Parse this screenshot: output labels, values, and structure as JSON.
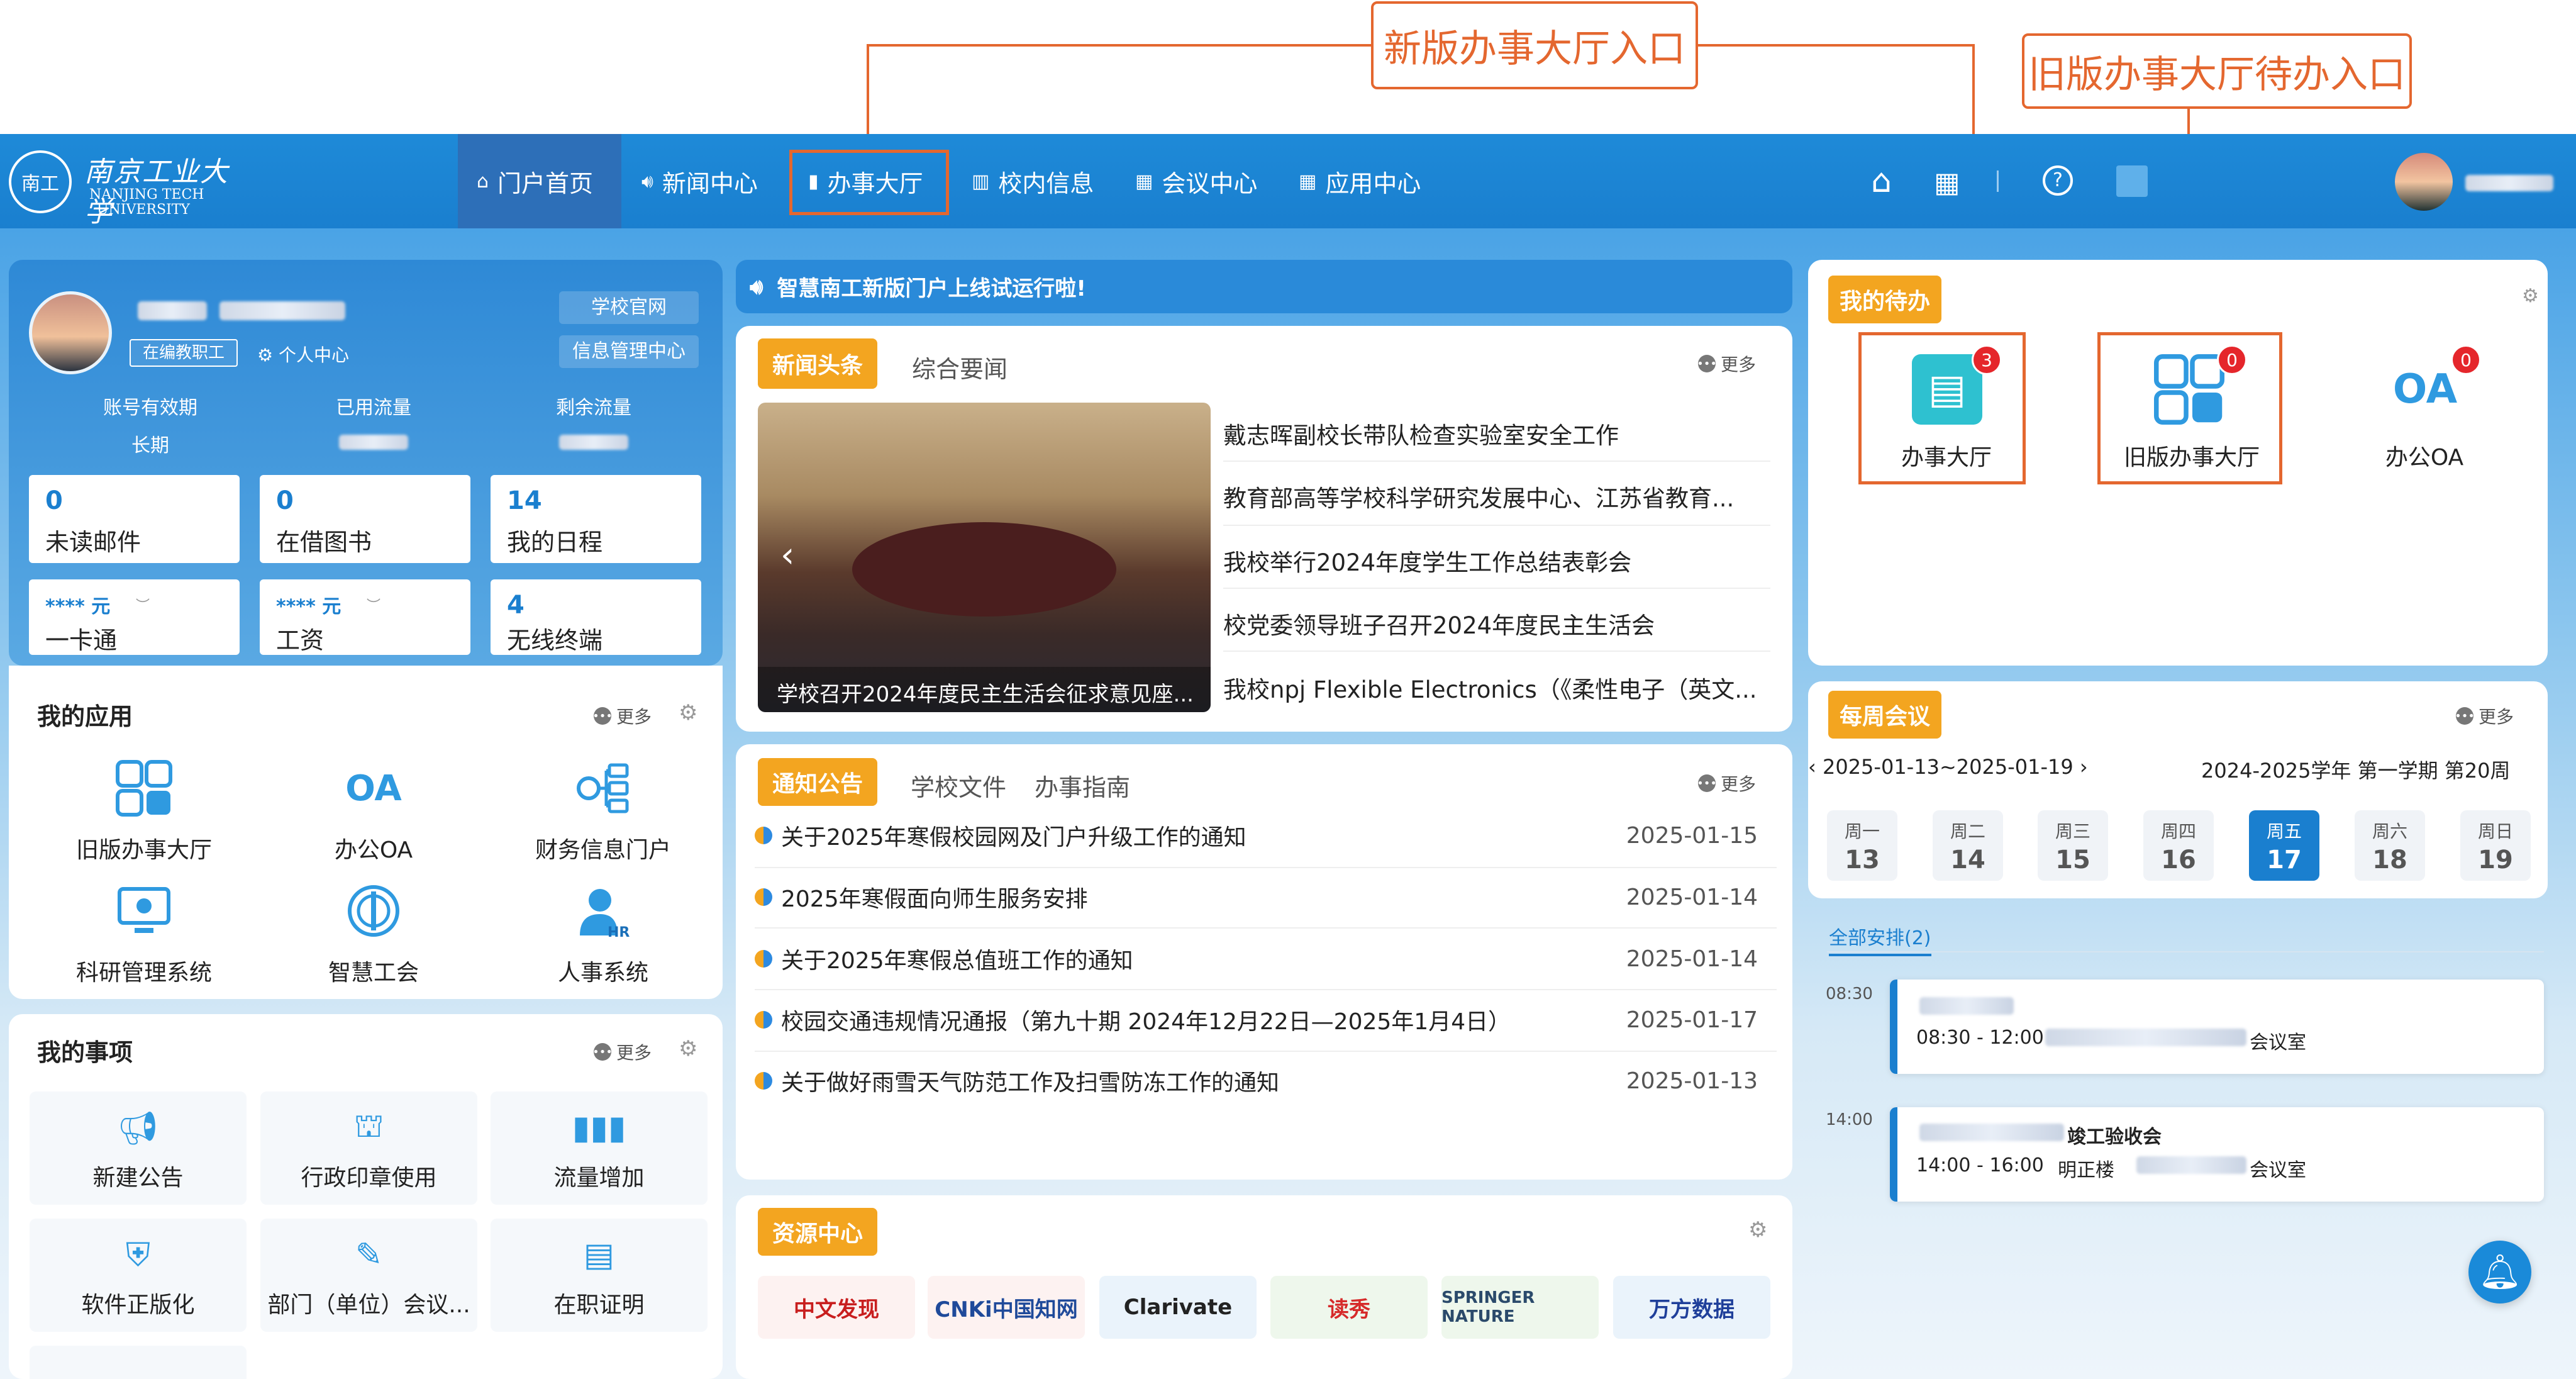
{
  "annotations": {
    "new_entry": "新版办事大厅入口",
    "old_entry": "旧版办事大厅待办入口"
  },
  "header": {
    "logo_cn": "南京工业大学",
    "logo_en1": "NANJING TECH",
    "logo_en2": "UNIVERSITY",
    "nav": [
      {
        "label": "门户首页",
        "icon": "home-icon"
      },
      {
        "label": "新闻中心",
        "icon": "speaker-icon"
      },
      {
        "label": "办事大厅",
        "icon": "briefcase-icon"
      },
      {
        "label": "校内信息",
        "icon": "building-icon"
      },
      {
        "label": "会议中心",
        "icon": "calendar-icon"
      },
      {
        "label": "应用中心",
        "icon": "grid-icon"
      }
    ]
  },
  "profile": {
    "status_badge": "在编教职工",
    "personal_center": "个人中心",
    "school_site": "学校官网",
    "info_center": "信息管理中心",
    "stat_labels": [
      "账号有效期",
      "已用流量",
      "剩余流量"
    ],
    "account_validity": "长期",
    "boxes": [
      {
        "value": "0",
        "label": "未读邮件"
      },
      {
        "value": "0",
        "label": "在借图书"
      },
      {
        "value": "14",
        "label": "我的日程"
      },
      {
        "value": "**** 元",
        "label": "一卡通"
      },
      {
        "value": "**** 元",
        "label": "工资"
      },
      {
        "value": "4",
        "label": "无线终端"
      }
    ]
  },
  "my_apps": {
    "title": "我的应用",
    "more": "更多",
    "items": [
      "旧版办事大厅",
      "办公OA",
      "财务信息门户",
      "科研管理系统",
      "智慧工会",
      "人事系统"
    ]
  },
  "my_matters": {
    "title": "我的事项",
    "more": "更多",
    "items": [
      "新建公告",
      "行政印章使用",
      "流量增加",
      "软件正版化",
      "部门（单位）会议...",
      "在职证明"
    ]
  },
  "banner": {
    "text": "智慧南工新版门户上线试运行啦!"
  },
  "news": {
    "tabs": [
      "新闻头条",
      "综合要闻"
    ],
    "more": "更多",
    "photo_caption": "学校召开2024年度民主生活会征求意见座...",
    "items": [
      "戴志晖副校长带队检查实验室安全工作",
      "教育部高等学校科学研究发展中心、江苏省教育...",
      "我校举行2024年度学生工作总结表彰会",
      "校党委领导班子召开2024年度民主生活会",
      "我校npj Flexible Electronics（《柔性电子（英文..."
    ]
  },
  "notices": {
    "tabs": [
      "通知公告",
      "学校文件",
      "办事指南"
    ],
    "more": "更多",
    "items": [
      {
        "title": "关于2025年寒假校园网及门户升级工作的通知",
        "date": "2025-01-15"
      },
      {
        "title": "2025年寒假面向师生服务安排",
        "date": "2025-01-14"
      },
      {
        "title": "关于2025年寒假总值班工作的通知",
        "date": "2025-01-14"
      },
      {
        "title": "校园交通违规情况通报（第九十期 2024年12月22日—2025年1月4日）",
        "date": "2025-01-17"
      },
      {
        "title": "关于做好雨雪天气防范工作及扫雪防冻工作的通知",
        "date": "2025-01-13"
      }
    ]
  },
  "resources": {
    "title": "资源中心",
    "items": [
      "中文发现",
      "CNKi中国知网",
      "Clarivate",
      "读秀",
      "SPRINGER NATURE",
      "万方数据"
    ]
  },
  "todo": {
    "title": "我的待办",
    "items": [
      {
        "label": "办事大厅",
        "count": "3"
      },
      {
        "label": "旧版办事大厅",
        "count": "0"
      },
      {
        "label": "办公OA",
        "count": "0"
      }
    ]
  },
  "meetings": {
    "title": "每周会议",
    "more": "更多",
    "range": "2025-01-13~2025-01-19",
    "term": "2024-2025学年 第一学期 第20周",
    "days": [
      {
        "name": "周一",
        "date": "13"
      },
      {
        "name": "周二",
        "date": "14"
      },
      {
        "name": "周三",
        "date": "15"
      },
      {
        "name": "周四",
        "date": "16"
      },
      {
        "name": "周五",
        "date": "17"
      },
      {
        "name": "周六",
        "date": "18"
      },
      {
        "name": "周日",
        "date": "19"
      }
    ],
    "all_label": "全部安排(2)",
    "events": [
      {
        "start": "08:30",
        "time": "08:30 - 12:00",
        "place": "会议室",
        "title": ""
      },
      {
        "start": "14:00",
        "time": "14:00 - 16:00",
        "place": "明正楼",
        "place2": "会议室",
        "title": "竣工验收会"
      }
    ]
  },
  "colors": {
    "accent": "#1a7fcf",
    "tag": "#f3a520",
    "annotation": "#e4672f",
    "badge": "#e5262b"
  }
}
